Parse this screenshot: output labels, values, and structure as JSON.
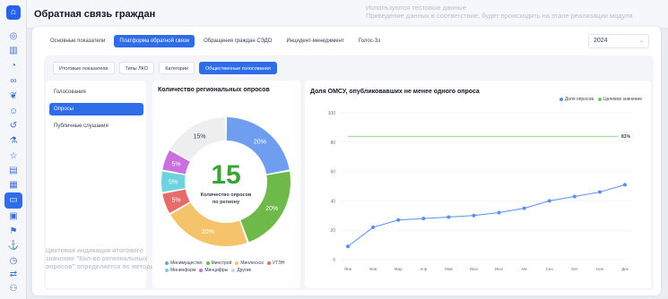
{
  "app": {
    "title": "Обратная связь граждан",
    "notice_line1": "Используются тестовые данные",
    "notice_line2": "Приведение данных в соответствие, будет происходить на этапе реализации модуля"
  },
  "sidebar": {
    "icons": [
      "logo-icon",
      "compass-icon",
      "bank-icon",
      "chart-icon",
      "link-icon",
      "leaf-icon",
      "users-icon",
      "history-icon",
      "flask-icon",
      "star-icon",
      "document-icon",
      "buildings-icon",
      "chat-icon",
      "building-icon",
      "flag-icon",
      "anchor-icon",
      "clock-icon",
      "refresh-icon",
      "user-shield-icon"
    ]
  },
  "tabs": [
    {
      "label": "Основные показатели",
      "active": false
    },
    {
      "label": "Платформа обратной связи",
      "active": true
    },
    {
      "label": "Обращения граждан СЭДО",
      "active": false
    },
    {
      "label": "Инцидент-менеджмент",
      "active": false
    },
    {
      "label": "Голос-Зз",
      "active": false
    }
  ],
  "year": {
    "value": "2024"
  },
  "subtabs": [
    {
      "label": "Итоговые показатели",
      "active": false
    },
    {
      "label": "Типы ЛКО",
      "active": false
    },
    {
      "label": "Категории",
      "active": false
    },
    {
      "label": "Общественные голосования",
      "active": true
    }
  ],
  "left_list": [
    {
      "label": "Голосования",
      "active": false
    },
    {
      "label": "Опросы",
      "active": true
    },
    {
      "label": "Публичные слушания",
      "active": false
    }
  ],
  "footnote": "Цветовая индикация итогового значения \"Кол-во региональных опросов\" определяется по методике",
  "chart_data": [
    {
      "type": "pie",
      "title": "Количество региональных опросов",
      "center_value": "15",
      "center_label": "Количество опросов по региону",
      "slices": [
        {
          "name": "Минимущество",
          "value": 20,
          "label": "20%",
          "color": "#6f9ef0"
        },
        {
          "name": "Минстрой",
          "value": 20,
          "label": "20%",
          "color": "#6fb84a"
        },
        {
          "name": "Минлесхоз",
          "value": 20,
          "label": "20%",
          "color": "#f5c46a"
        },
        {
          "name": "УТЭН",
          "value": 5,
          "label": "5%",
          "color": "#e86b6b"
        },
        {
          "name": "Мининформ",
          "value": 5,
          "label": "5%",
          "color": "#6cd3df"
        },
        {
          "name": "Минцифры",
          "value": 5,
          "label": "5%",
          "color": "#c96fe0"
        },
        {
          "name": "Другие",
          "value": 15,
          "label": "15%",
          "color": "#eeeeee"
        }
      ]
    },
    {
      "type": "line",
      "title": "Доля ОМСУ, опубликовавших не менее одного опроса",
      "categories": [
        "Янв",
        "Фев",
        "Мар",
        "Апр",
        "Май",
        "Июн",
        "Июл",
        "Авг",
        "Сен",
        "Окт",
        "Ноя",
        "Дек"
      ],
      "series": [
        {
          "name": "Доля опросов",
          "color": "#5b8def",
          "values": [
            9,
            22,
            27,
            28,
            29,
            30,
            32,
            35,
            40,
            43,
            46,
            51
          ]
        },
        {
          "name": "Целевое значение",
          "color": "#7fc25a",
          "values": [
            84,
            84,
            84,
            84,
            84,
            84,
            84,
            84,
            84,
            84,
            84,
            84
          ]
        }
      ],
      "target_label": "81%",
      "ylim": [
        0,
        100
      ],
      "yticks": [
        0,
        20,
        40,
        60,
        80,
        100
      ],
      "legend_position": "top-right",
      "grid": true
    }
  ]
}
